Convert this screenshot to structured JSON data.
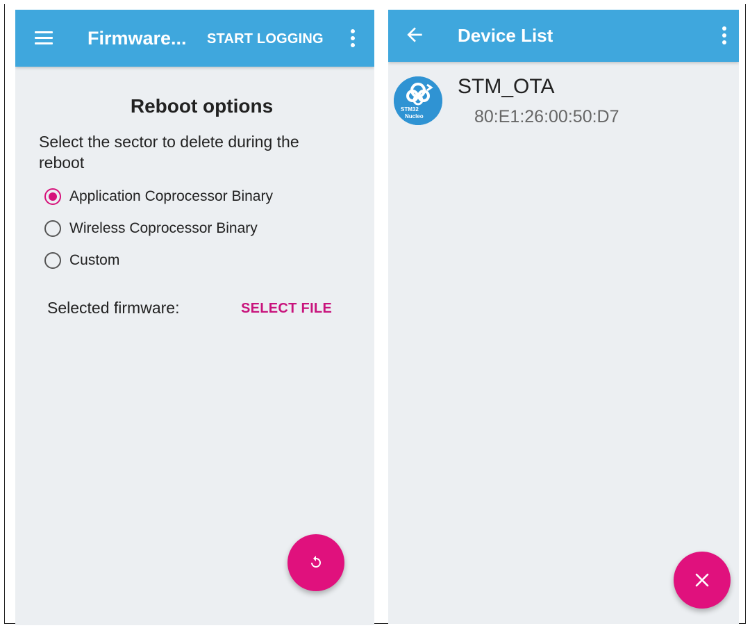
{
  "left_screen": {
    "appbar": {
      "menu_icon": "hamburger-menu-icon",
      "title": "Firmware...",
      "start_logging_label": "START LOGGING",
      "overflow_icon": "more-vert-icon"
    },
    "heading": "Reboot options",
    "instruction": "Select the sector to delete during the reboot",
    "options": [
      {
        "label": "Application Coprocessor Binary",
        "checked": true
      },
      {
        "label": "Wireless Coprocessor Binary",
        "checked": false
      },
      {
        "label": "Custom",
        "checked": false
      }
    ],
    "selected_firmware_label": "Selected firmware:",
    "select_file_label": "SELECT FILE",
    "fab_icon": "reboot-icon"
  },
  "right_screen": {
    "appbar": {
      "back_icon": "arrow-back-icon",
      "title": "Device List",
      "overflow_icon": "more-vert-icon"
    },
    "devices": [
      {
        "name": "STM_OTA",
        "address": "80:E1:26:00:50:D7",
        "icon": "stm32-nucleo-icon",
        "icon_text_top": "STM32",
        "icon_text_bottom": "Nucleo"
      }
    ],
    "fab_icon": "close-icon"
  },
  "colors": {
    "appbar": "#3fa7dd",
    "accent": "#d6117a",
    "fab": "#e0117d",
    "background": "#eceff2"
  }
}
